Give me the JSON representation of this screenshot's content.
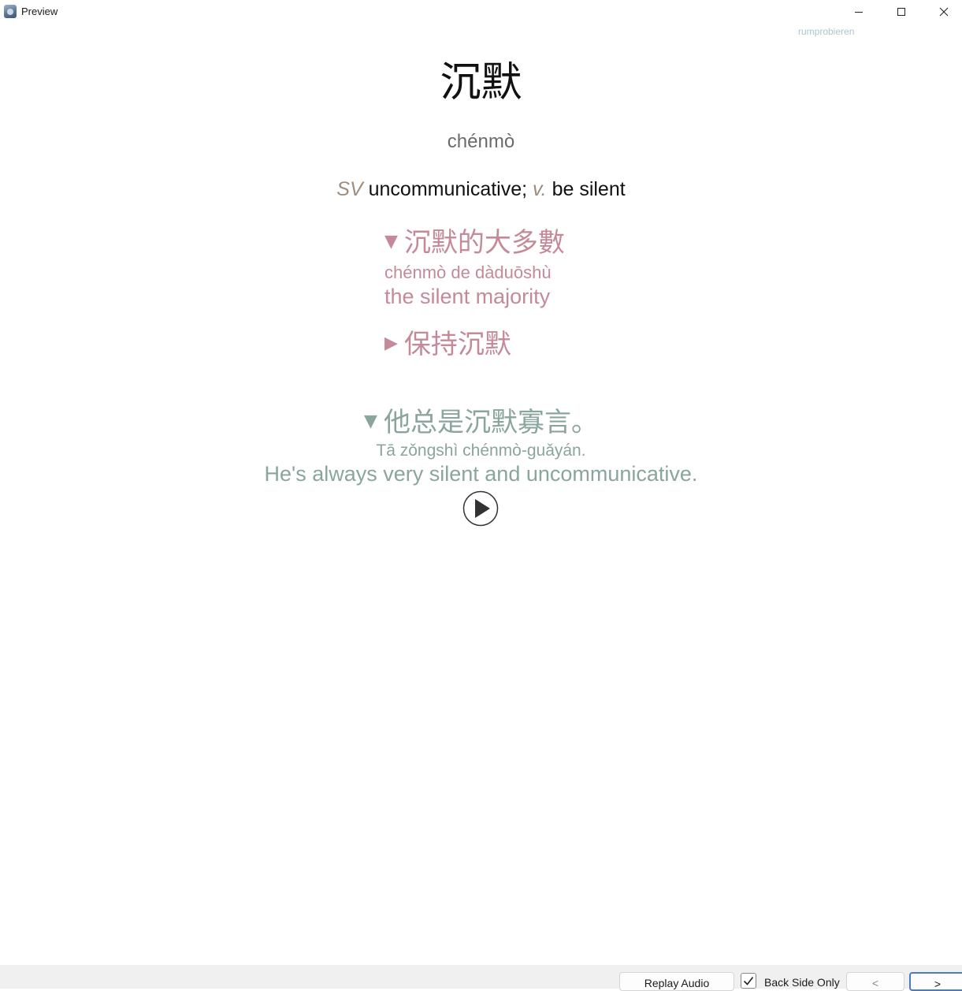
{
  "window": {
    "title": "Preview",
    "controls": [
      "minimize-icon",
      "maximize-icon",
      "close-icon"
    ]
  },
  "card": {
    "top_link": "rumprobieren",
    "hanzi": "沉默",
    "pinyin": "chénmò",
    "definition": {
      "pos1": "SV",
      "def1": " uncommunicative; ",
      "pos2": "v.",
      "def2": " be silent"
    },
    "examples": [
      {
        "arrow": "▼",
        "hanzi": "沉默的大多數",
        "pinyin": "chénmò de dàduōshù",
        "english": "the silent majority",
        "expanded": true
      },
      {
        "arrow": "▶",
        "hanzi": "保持沉默",
        "expanded": false
      }
    ],
    "sentence": {
      "arrow": "▼",
      "hanzi": "他总是沉默寡言。",
      "pinyin": "Tā zǒngshì chénmò-guǎyán.",
      "english": "He's always very silent and uncommunicative."
    },
    "colors": {
      "example": "#c48a99",
      "sentence": "#8aa59e",
      "pos": "#a08c7c"
    }
  },
  "bottom_bar": {
    "replay_label": "Replay Audio",
    "back_side_only_label": "Back Side Only",
    "back_side_only_checked": true,
    "prev_label": "<",
    "next_label": ">"
  }
}
